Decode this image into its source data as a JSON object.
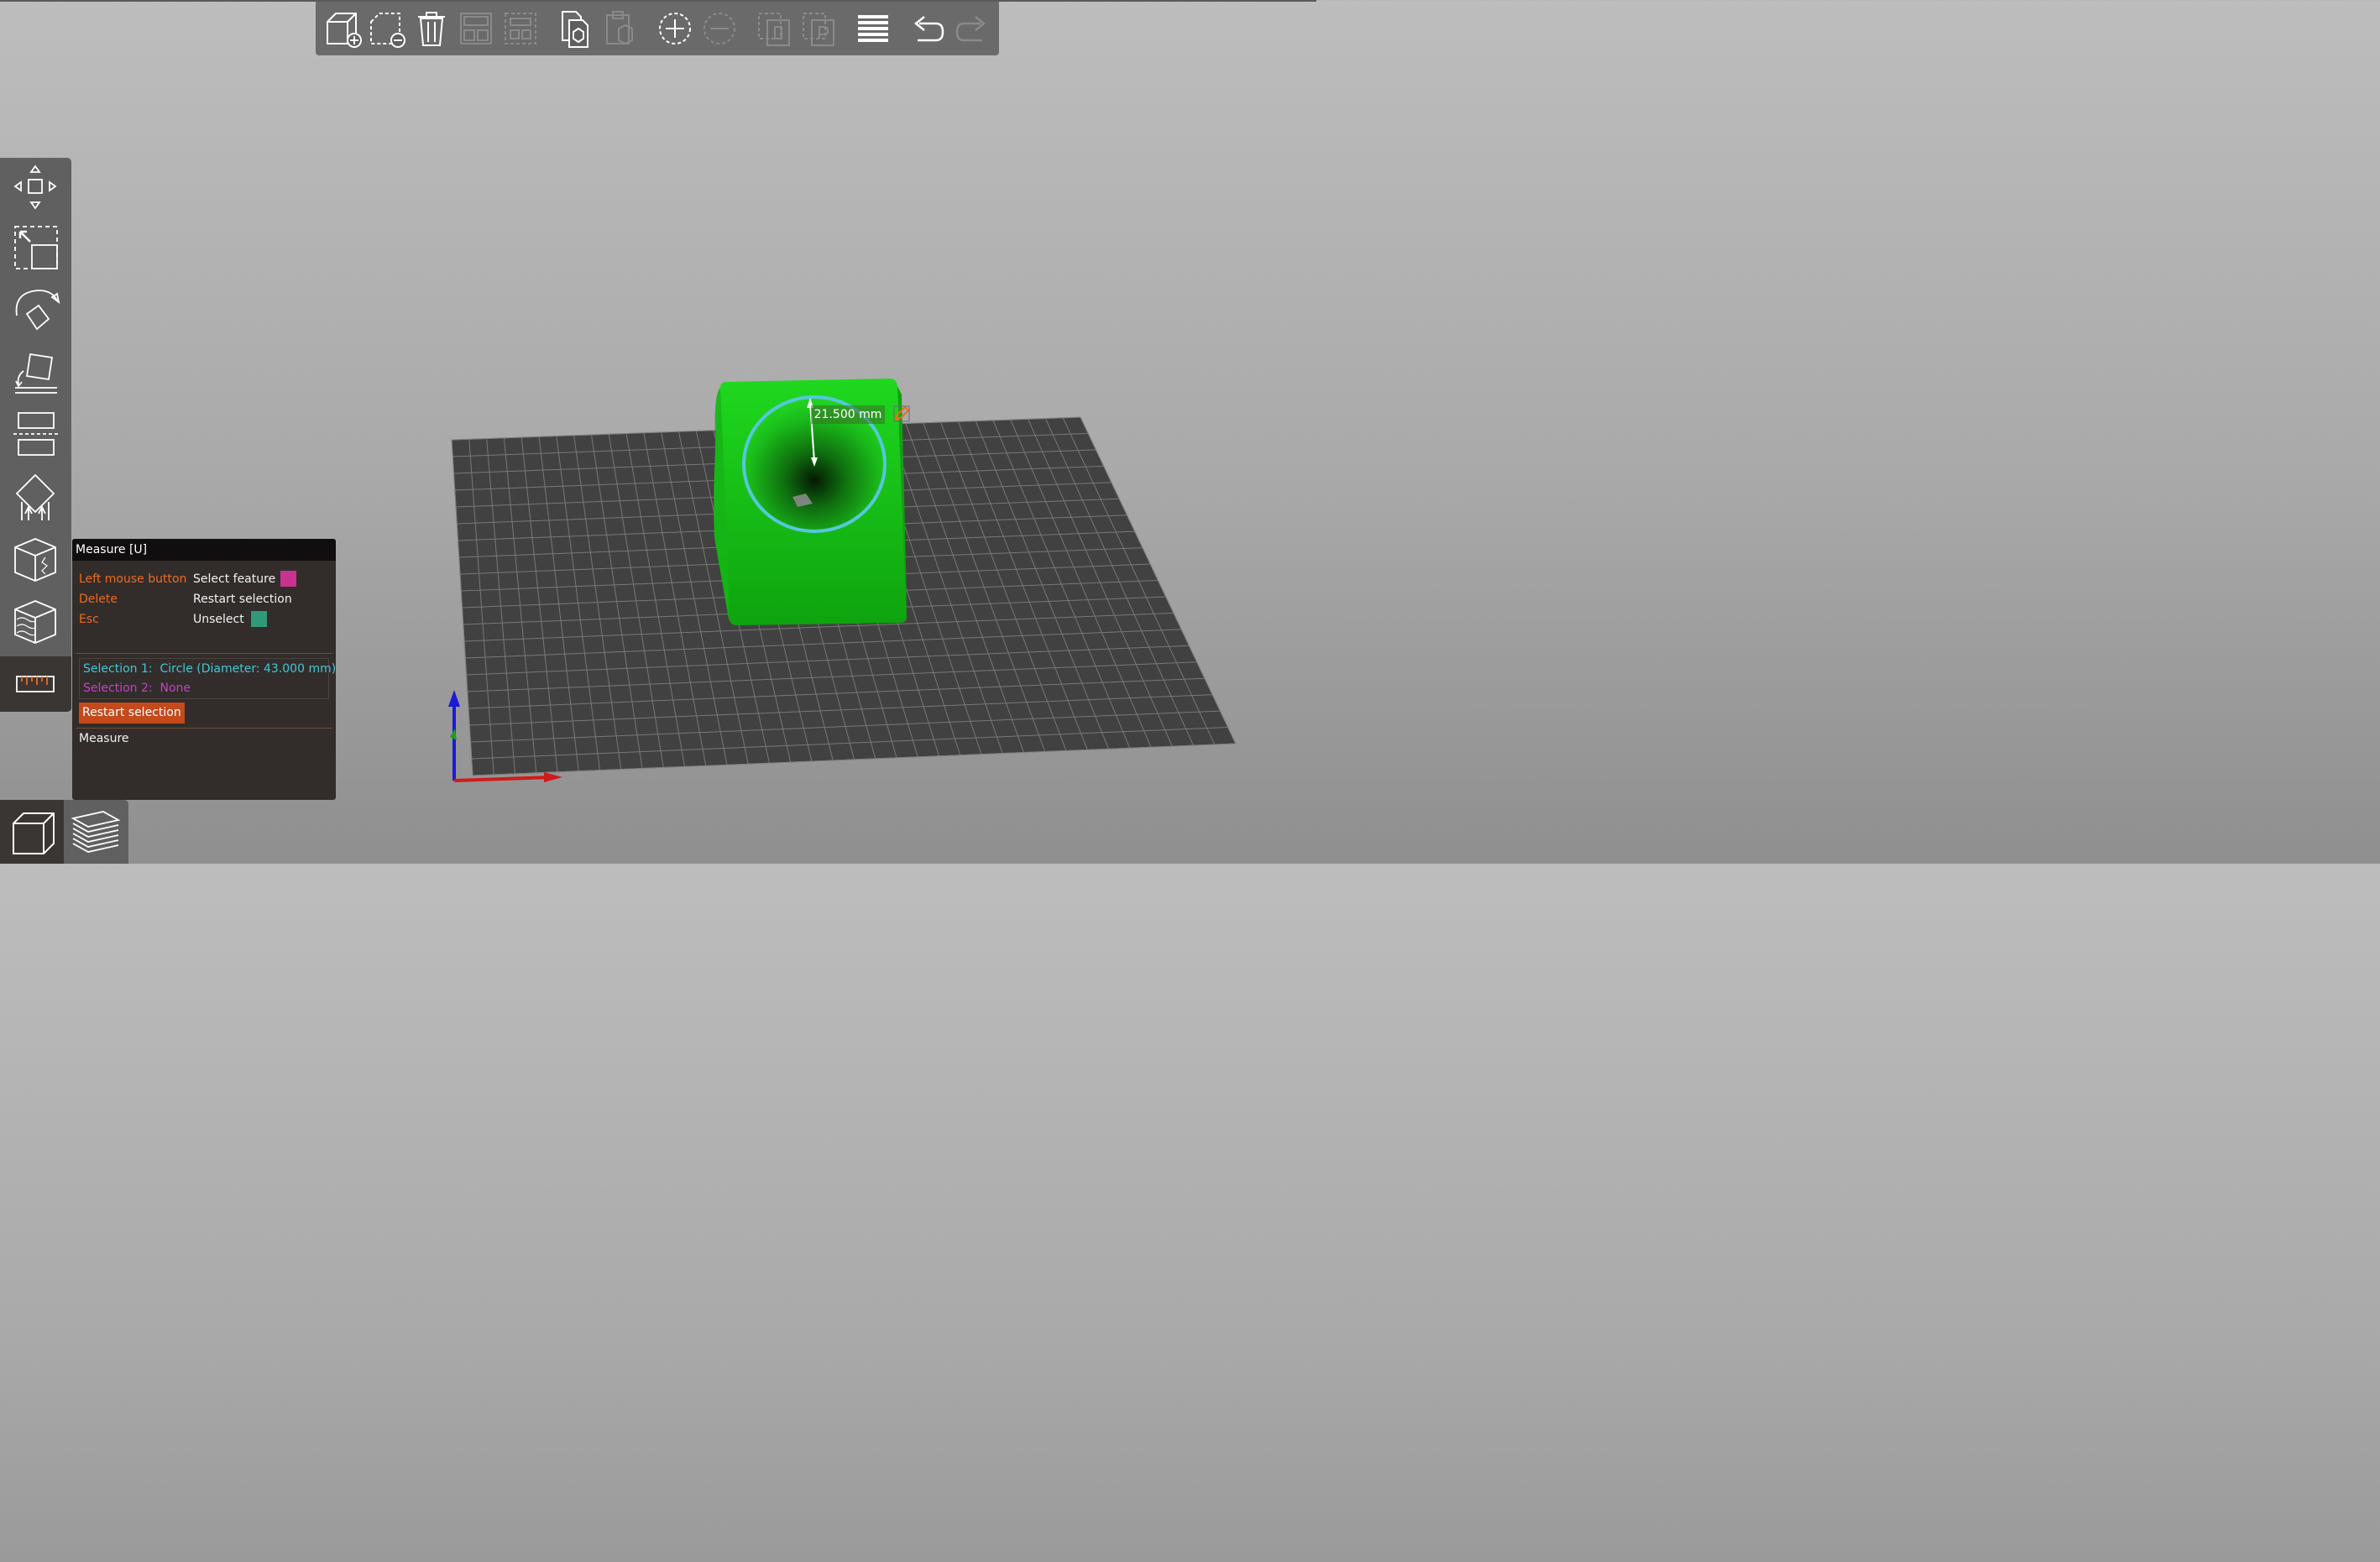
{
  "toolbar": {
    "buttons": [
      {
        "name": "add",
        "enabled": true
      },
      {
        "name": "delete",
        "enabled": true
      },
      {
        "name": "delete-all",
        "enabled": true
      },
      {
        "name": "arrange",
        "enabled": false
      },
      {
        "name": "arrange-selection",
        "enabled": false
      },
      {
        "name": "copy",
        "enabled": true
      },
      {
        "name": "paste",
        "enabled": false
      },
      {
        "name": "add-instance",
        "enabled": true
      },
      {
        "name": "remove-instance",
        "enabled": false
      },
      {
        "name": "split-to-objects",
        "enabled": false
      },
      {
        "name": "split-to-parts",
        "enabled": false
      },
      {
        "name": "layers-editing",
        "enabled": true
      },
      {
        "name": "undo",
        "enabled": true
      },
      {
        "name": "redo",
        "enabled": false
      }
    ]
  },
  "sidebar": {
    "tools": [
      "move-icon",
      "scale-icon",
      "rotate-icon",
      "place-on-face-icon",
      "cut-icon",
      "support-painting-icon",
      "seam-painting-icon",
      "fdm-supports-icon",
      "measure-icon"
    ],
    "active": "measure-icon"
  },
  "view_toggle": {
    "items": [
      "3d-view-icon",
      "preview-icon"
    ],
    "active": "3d-view-icon"
  },
  "measure_panel": {
    "title": "Measure [U]",
    "shortcuts": [
      {
        "key": "Left mouse button",
        "action": "Select feature",
        "swatch": "#c8338f"
      },
      {
        "key": "Delete",
        "action": "Restart selection"
      },
      {
        "key": "Esc",
        "action": "Unselect",
        "swatch": "#2f9a78"
      }
    ],
    "selection1": {
      "label": "Selection 1:",
      "value": "Circle (Diameter: 43.000 mm)",
      "color": "#42c6d9"
    },
    "selection2": {
      "label": "Selection 2:",
      "value": "None",
      "color": "#c640c8"
    },
    "restart_button": "Restart selection",
    "measure_label": "Measure"
  },
  "viewport": {
    "dimension_label": "21.500 mm",
    "object_color": "#1ed01e",
    "selection_ring_color": "#55c8dc"
  }
}
